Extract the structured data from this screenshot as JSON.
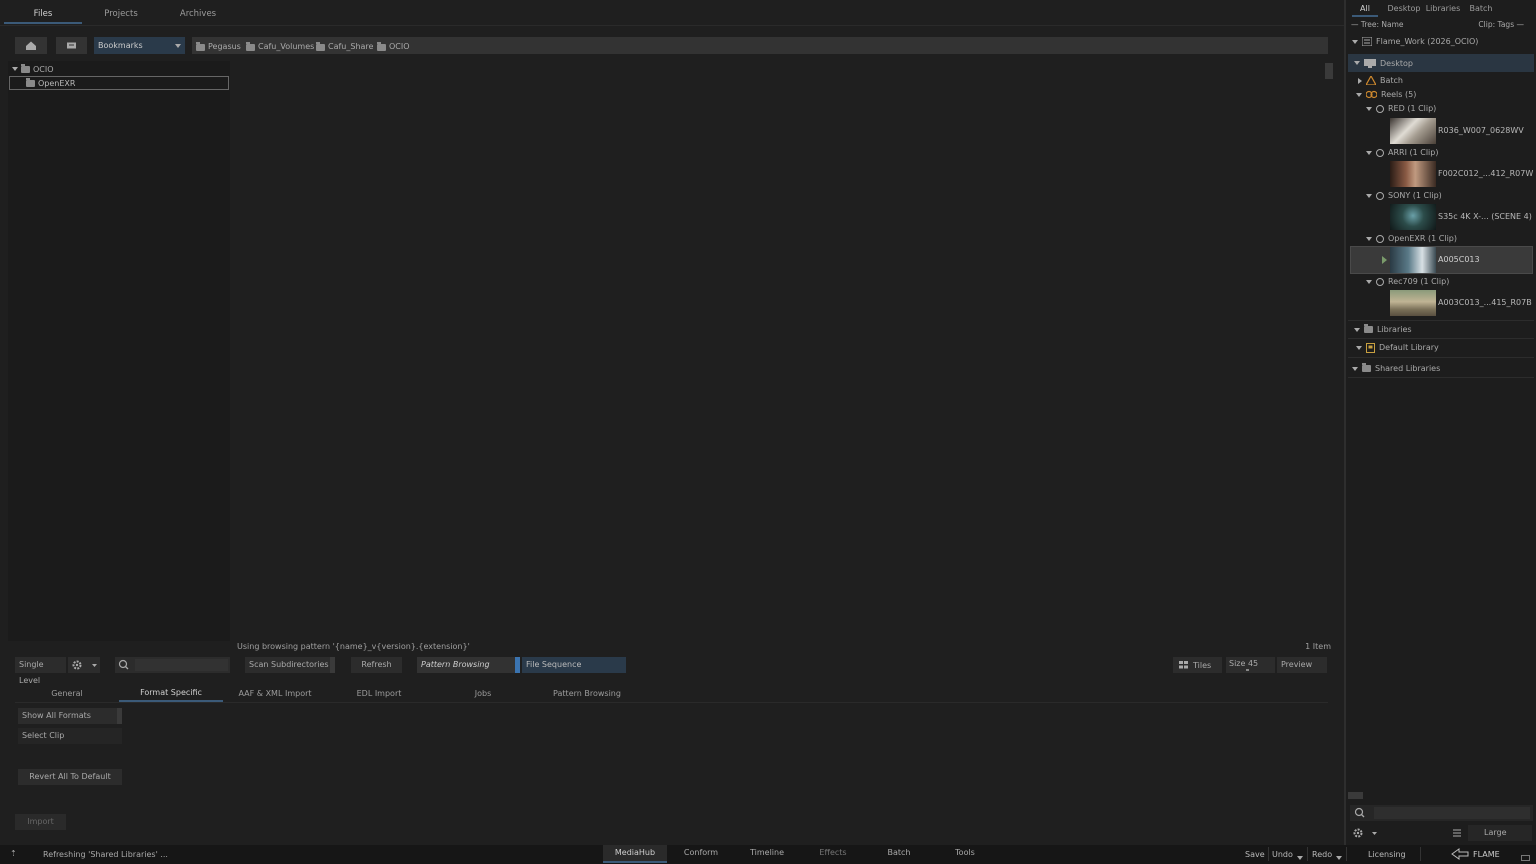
{
  "main_tabs": [
    "Files",
    "Projects",
    "Archives"
  ],
  "toolbar": {
    "bookmarks_label": "Bookmarks",
    "breadcrumbs": [
      "Pegasus",
      "Cafu_Volumes",
      "Cafu_Share",
      "OCIO"
    ]
  },
  "tree": {
    "root": "OCIO",
    "child": "OpenEXR"
  },
  "status": {
    "pattern_text": "Using browsing pattern '{name}_v{version}.{extension}'",
    "item_count": "1 Item"
  },
  "controls": {
    "single_level": "Single Level",
    "scan_subdirectories": "Scan Subdirectories",
    "refresh": "Refresh",
    "pattern_browsing": "Pattern Browsing",
    "file_sequence": "File Sequence",
    "tiles": "Tiles",
    "size": "Size 45",
    "preview": "Preview"
  },
  "sub_tabs": [
    "General",
    "Format Specific",
    "AAF & XML Import",
    "EDL Import",
    "Jobs",
    "Pattern Browsing"
  ],
  "format_panel": {
    "show_all_formats": "Show All Formats",
    "select_clip": "Select Clip",
    "revert_all": "Revert All To Default",
    "import": "Import"
  },
  "right_panel": {
    "tabs": [
      "All",
      "Desktop",
      "Libraries",
      "Batch"
    ],
    "tree_sort": "— Tree: Name",
    "clip_sort": "Clip: Tags —",
    "workspace": "Flame_Work (2026_OCIO)",
    "desktop": "Desktop",
    "batch": "Batch",
    "reels": "Reels (5)",
    "reel_groups": [
      {
        "name": "RED (1 Clip)",
        "clip": "R036_W007_0628WV",
        "color": "#7a6a5c"
      },
      {
        "name": "ARRI (1 Clip)",
        "clip": "F002C012_...412_R07W",
        "color": "#6b4a3a"
      },
      {
        "name": "SONY (1 Clip)",
        "clip": "S35c 4K X-... (SCENE 4)",
        "color": "#2c4c4a"
      },
      {
        "name": "OpenEXR (1 Clip)",
        "clip": "A005C013",
        "color": "#4e6470"
      },
      {
        "name": "Rec709 (1 Clip)",
        "clip": "A003C013_...415_R07B",
        "color": "#7a7058"
      }
    ],
    "libraries": "Libraries",
    "default_library": "Default Library",
    "shared_libraries": "Shared Libraries",
    "view_size": "Large"
  },
  "bottom_bar": {
    "status": "Refreshing 'Shared Libraries' ...",
    "tabs": [
      "MediaHub",
      "Conform",
      "Timeline",
      "Effects",
      "Batch",
      "Tools"
    ],
    "save": "Save",
    "undo": "Undo",
    "redo": "Redo",
    "licensing": "Licensing",
    "brand": "FLAME"
  }
}
